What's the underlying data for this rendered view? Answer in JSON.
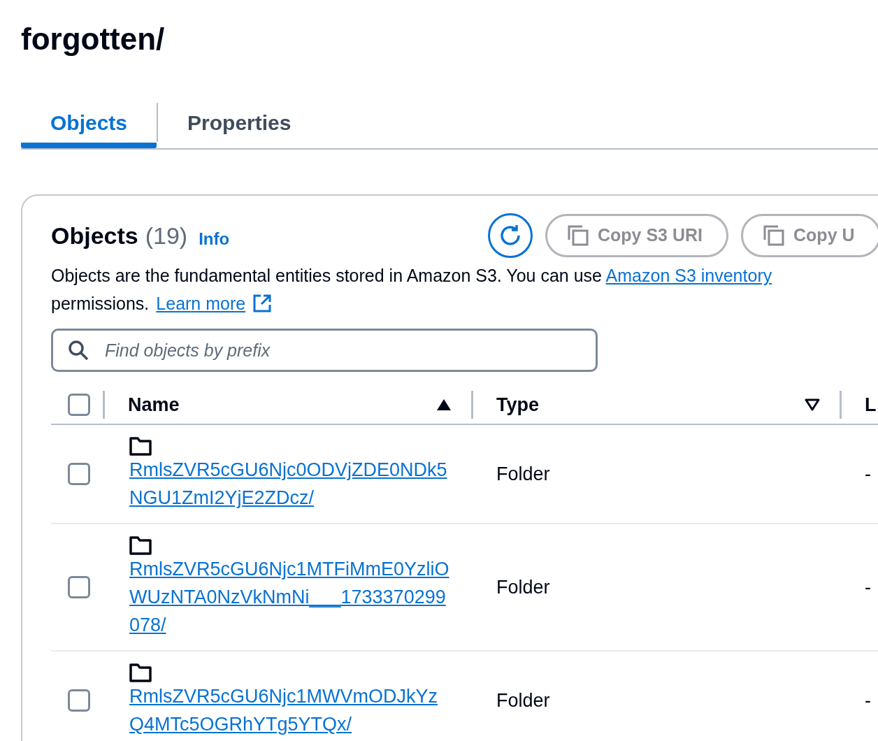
{
  "page_title": "forgotten/",
  "tabs": [
    {
      "label": "Objects",
      "selected": true
    },
    {
      "label": "Properties",
      "selected": false
    }
  ],
  "objects_panel": {
    "heading": "Objects",
    "count": "(19)",
    "info_link": "Info",
    "buttons": [
      {
        "kind": "refresh"
      },
      {
        "kind": "copy",
        "label": "Copy S3 URI"
      },
      {
        "kind": "copy",
        "label": "Copy U"
      }
    ],
    "description": {
      "text_before": "Objects are the fundamental entities stored in Amazon S3. You can use ",
      "link": "Amazon S3 inventory",
      "text_after": "permissions.",
      "learn_more": "Learn more"
    },
    "search": {
      "placeholder": "Find objects by prefix"
    },
    "table": {
      "select_all_checked": false,
      "columns": [
        {
          "label": "Name",
          "kind": "sorted"
        },
        {
          "label": "Type",
          "kind": "sortable"
        },
        {
          "label": "L",
          "kind": "plain"
        }
      ],
      "rows": [
        {
          "checked": false,
          "name": "RmlsZVR5cGU6Njc0ODVjZDE0NDk5NGU1ZmI2YjE2ZDcz/",
          "type": "Folder",
          "column_3": "-"
        },
        {
          "checked": false,
          "name": "RmlsZVR5cGU6Njc1MTFiMmE0YzliOWUzNTA0NzVkNmNi___1733370299078/",
          "type": "Folder",
          "column_3": "-"
        },
        {
          "checked": false,
          "name": "RmlsZVR5cGU6Njc1MWVmODJkYzQ4MTc5OGRhYTg5YTQx/",
          "type": "Folder",
          "column_3": "-"
        }
      ]
    }
  }
}
